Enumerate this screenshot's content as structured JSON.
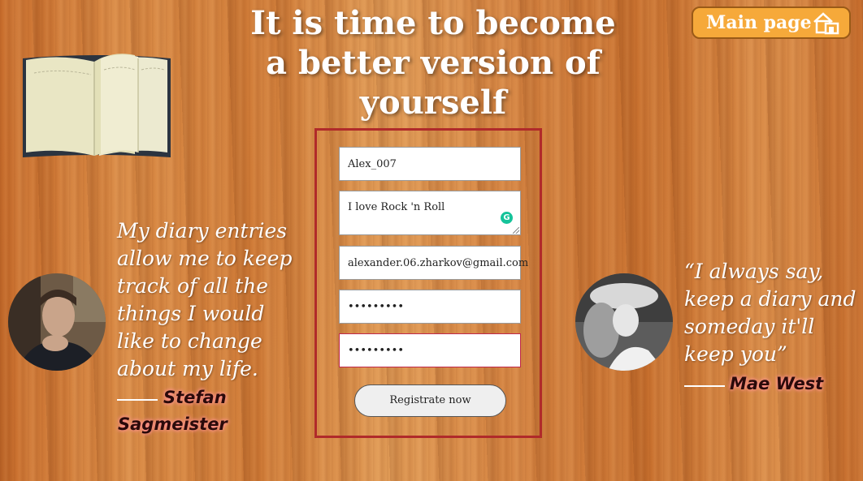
{
  "header": {
    "title_line1": "It is time to become",
    "title_line2": "a better version of",
    "title_line3": "yourself",
    "main_page_label": "Main page"
  },
  "form": {
    "username_value": "Alex_007",
    "about_value": "I love Rock 'n Roll",
    "email_value": "alexander.06.zharkov@gmail.com",
    "password_value": "•••••••••",
    "password_confirm_value": "•••••••••",
    "submit_label": "Registrate now"
  },
  "quotes": {
    "left_text": "My diary entries allow me to keep track of all the things I would like to change about my life.",
    "left_author_line1": "Stefan",
    "left_author_line2": "Sagmeister",
    "right_text": "“I always say, keep a diary and someday it'll keep you”",
    "right_author": "Mae West"
  },
  "icons": {
    "home": "home-icon",
    "book": "book-icon",
    "grammarly": "grammarly-icon"
  },
  "colors": {
    "main_button": "#f6a93a",
    "form_border": "#b02a2a",
    "error_border": "#c0284a",
    "author_glow": "#ff8a8a"
  }
}
